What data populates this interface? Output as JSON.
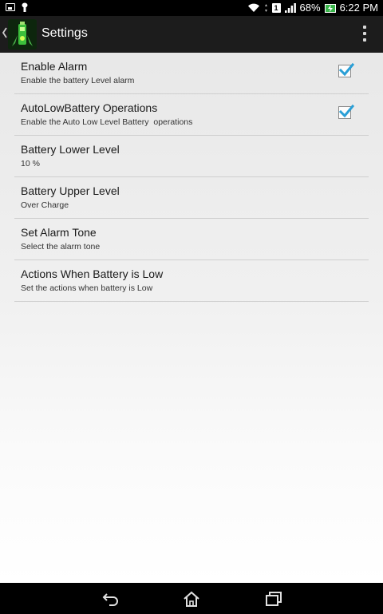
{
  "status_bar": {
    "battery_percent": "68%",
    "time": "6:22 PM",
    "sim_label": "1",
    "icons": [
      "image-icon",
      "android-icon",
      "wifi-icon",
      "sim-icon",
      "signal-icon",
      "battery-charging-icon"
    ]
  },
  "action_bar": {
    "title": "Settings",
    "icons": [
      "back-chevron-icon",
      "app-battery-icon",
      "overflow-menu-icon"
    ]
  },
  "preferences": [
    {
      "title": "Enable Alarm",
      "summary": "Enable the battery Level alarm",
      "checkbox": true,
      "checked": true
    },
    {
      "title": "AutoLowBattery Operations",
      "summary": "Enable the Auto Low Level Battery  operations",
      "checkbox": true,
      "checked": true
    },
    {
      "title": "Battery Lower Level",
      "summary": "10 %",
      "checkbox": false
    },
    {
      "title": "Battery Upper Level",
      "summary": "Over Charge",
      "checkbox": false
    },
    {
      "title": "Set Alarm Tone",
      "summary": "Select the alarm tone",
      "checkbox": false
    },
    {
      "title": "Actions When Battery is Low",
      "summary": "Set the actions when battery is Low",
      "checkbox": false
    }
  ],
  "nav_bar": {
    "icons": [
      "back-icon",
      "home-icon",
      "recent-apps-icon"
    ]
  },
  "colors": {
    "checkbox_accent": "#2a9fd6",
    "battery_green": "#39b54a"
  }
}
